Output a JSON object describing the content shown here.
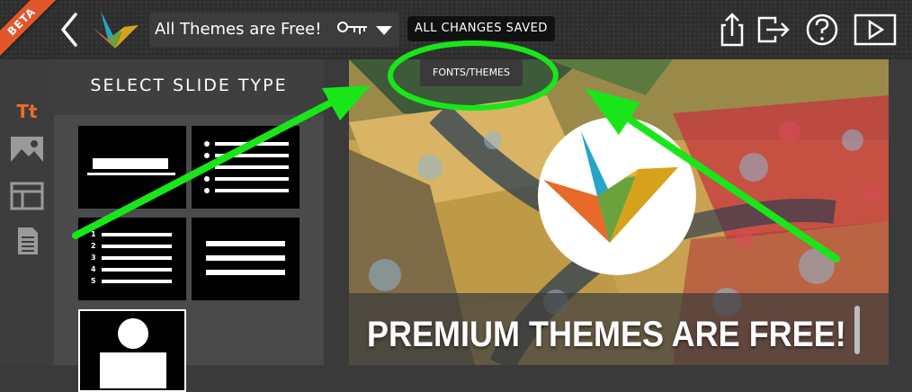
{
  "topbar": {
    "beta_label": "BETA",
    "presentation_title": "All Themes are Free!",
    "save_status": "ALL CHANGES SAVED",
    "icons": [
      "back-icon",
      "haiku-deck-logo",
      "key-icon",
      "chevron-down-icon",
      "share-icon",
      "exit-icon",
      "help-icon",
      "play-icon"
    ]
  },
  "tooltip": {
    "label": "FONTS/THEMES"
  },
  "rail": {
    "items": [
      "text-icon",
      "image-icon",
      "layout-icon",
      "notes-icon"
    ],
    "active": "text-icon",
    "accent": "#ee6a2c"
  },
  "panel": {
    "title": "SELECT SLIDE TYPE",
    "numbered_list": [
      "1",
      "2",
      "3",
      "4",
      "5"
    ]
  },
  "slide": {
    "caption": "PREMIUM THEMES ARE FREE!"
  },
  "annotation": {
    "color": "#19e619"
  }
}
